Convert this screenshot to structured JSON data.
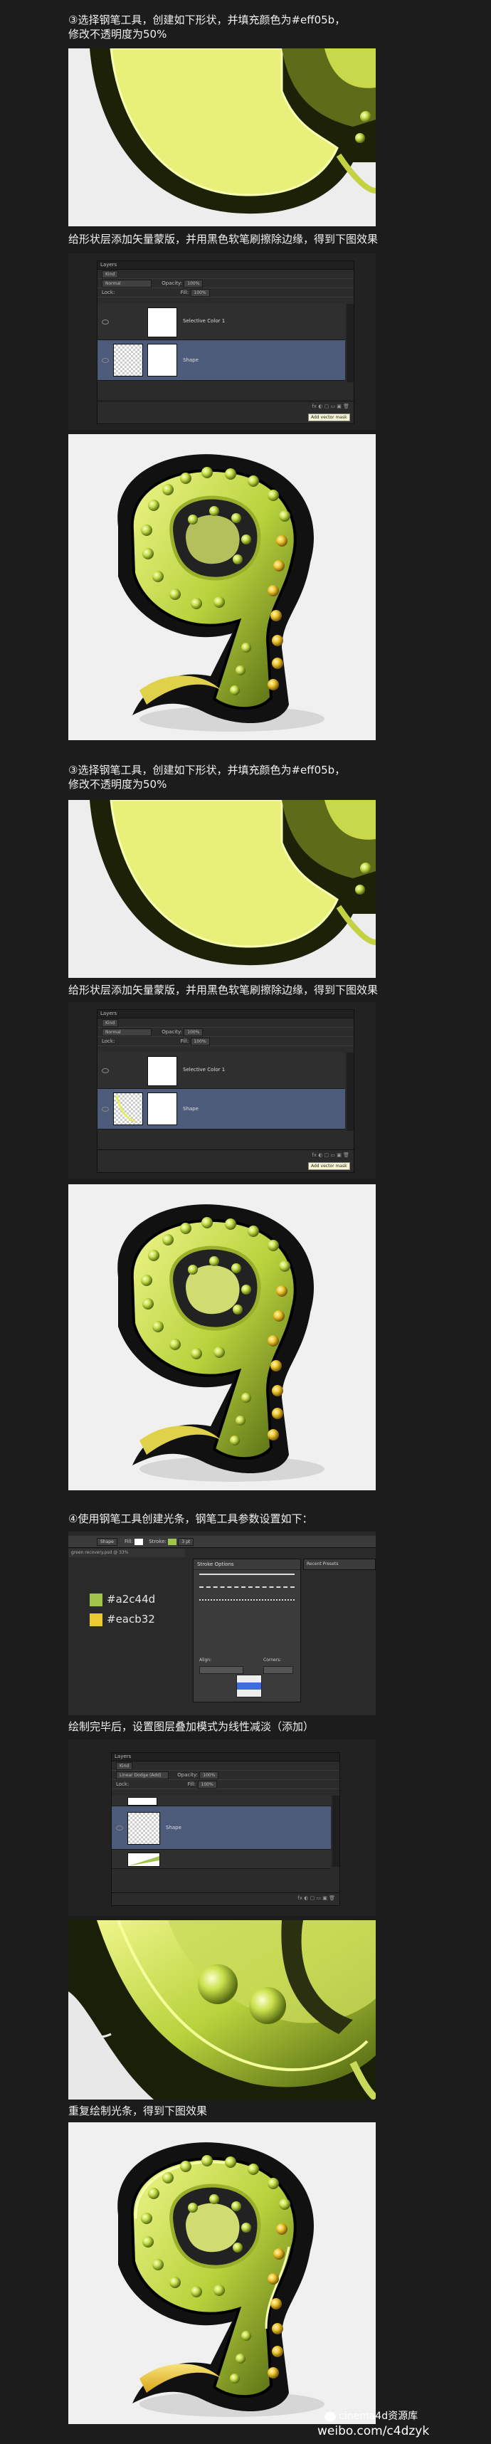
{
  "step3a": {
    "caption_line1": "③选择钢笔工具，创建如下形状，并填充颜色为#eff05b，",
    "caption_line2": "修改不透明度为50%",
    "mask_caption": "给形状层添加矢量蒙版，并用黑色软笔刷擦除边缘，得到下图效果"
  },
  "step3b": {
    "caption_line1": "③选择钢笔工具，创建如下形状，并填充颜色为#eff05b，",
    "caption_line2": "修改不透明度为50%",
    "mask_caption": "给形状层添加矢量蒙版，并用黑色软笔刷擦除边缘，得到下图效果"
  },
  "layers_panel": {
    "title": "Layers",
    "kind": "Kind",
    "blend_mode": "Normal",
    "opacity_label": "Opacity:",
    "opacity_value": "100%",
    "lock_label": "Lock:",
    "fill_label": "Fill:",
    "fill_value": "100%",
    "layer1_name": "Selective Color 1",
    "layer2_name": "Shape",
    "tooltip": "Add vector mask"
  },
  "step4": {
    "caption": "④使用钢笔工具创建光条，钢笔工具参数设置如下：",
    "color1": "#a2c44d",
    "color2": "#eacb32",
    "color1_hex": "#a2c44d",
    "color2_hex": "#eacb32",
    "options_shape": "Shape",
    "options_fill": "Fill:",
    "options_stroke": "Stroke:",
    "options_size": "3 pt",
    "stroke_options": "Stroke Options",
    "align": "Align:",
    "caps": "Corners:",
    "recent": "Recent Presets"
  },
  "blend_caption": "绘制完毕后，设置图层叠加模式为线性减淡（添加）",
  "blend_panel": {
    "title": "Layers",
    "kind": "Kind",
    "blend_mode": "Linear Dodge (Add)",
    "opacity_label": "Opacity:",
    "opacity_value": "100%",
    "lock_label": "Lock:",
    "fill_label": "Fill:",
    "fill_value": "100%",
    "layer_name": "Shape"
  },
  "repeat_caption": "重复绘制光条，得到下图效果",
  "watermark": {
    "line1": "cinema4d资源库",
    "line2": "weibo.com/c4dzyk"
  }
}
